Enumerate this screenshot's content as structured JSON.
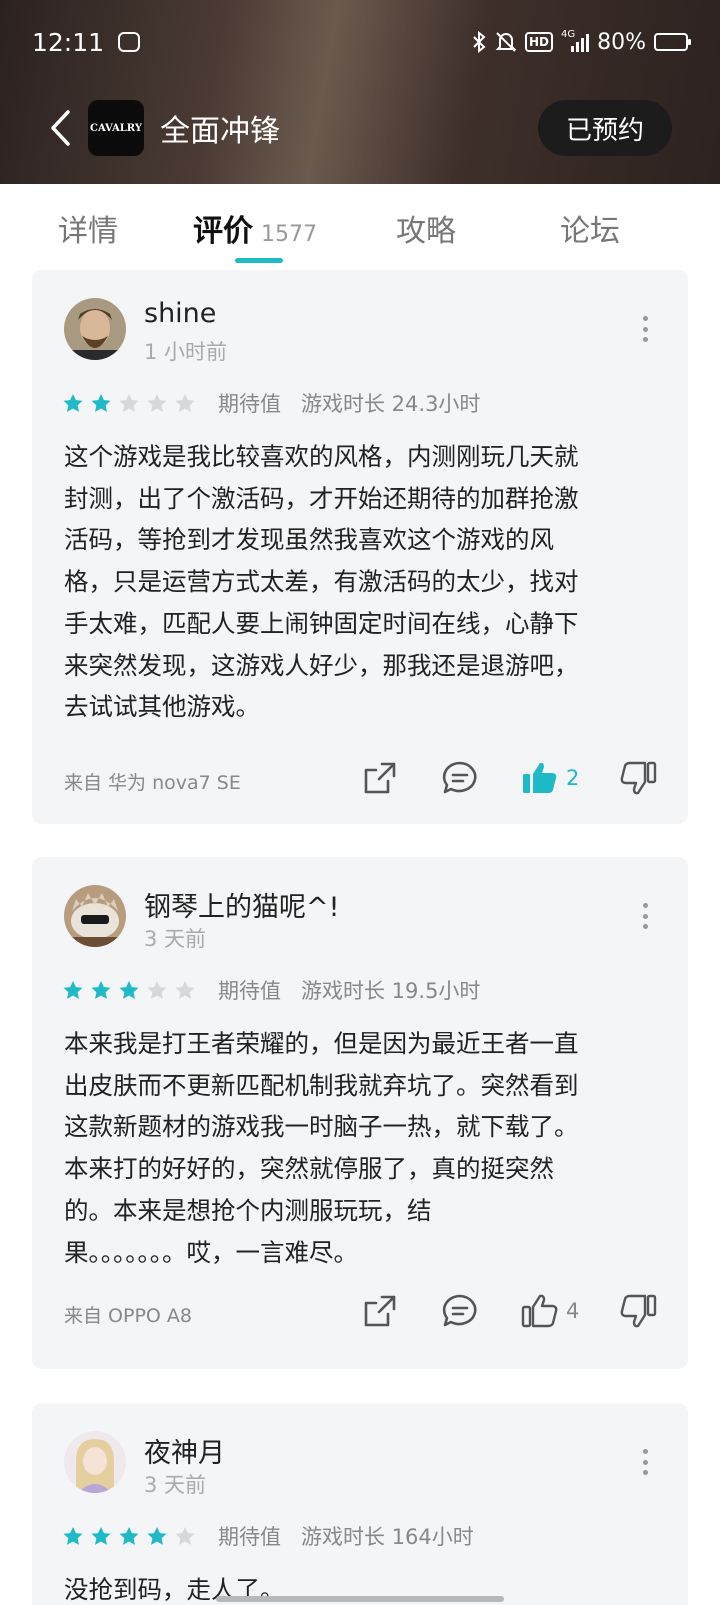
{
  "status_bar": {
    "time": "12:11",
    "hd": "HD",
    "network": "4G",
    "battery_text": "80%",
    "battery_level": 0.8
  },
  "header": {
    "logo_text": "CAVALRY",
    "title": "全面冲锋",
    "reserve_label": "已预约"
  },
  "tabs": [
    {
      "label": "详情"
    },
    {
      "label": "评价",
      "count": "1577"
    },
    {
      "label": "攻略"
    },
    {
      "label": "论坛"
    }
  ],
  "colors": {
    "accent": "#1fbac8",
    "star_off": "#d8d8d8"
  },
  "reviews": [
    {
      "name": "shine",
      "time": "1 小时前",
      "stars": 2,
      "expect_label": "期待值",
      "playtime": "游戏时长 24.3小时",
      "lines": [
        "这个游戏是我比较喜欢的风格，内测刚玩几天就",
        "封测，出了个激活码，才开始还期待的加群抢激",
        "活码，等抢到才发现虽然我喜欢这个游戏的风",
        "格，只是运营方式太差，有激活码的太少，找对",
        "手太难，匹配人要上闹钟固定时间在线，心静下",
        "来突然发现，这游戏人好少，那我还是退游吧，",
        "去试试其他游戏。"
      ],
      "device": "来自 华为 nova7 SE",
      "likes": "2",
      "liked": true
    },
    {
      "name": "钢琴上的猫呢^!",
      "time": "3 天前",
      "stars": 3,
      "expect_label": "期待值",
      "playtime": "游戏时长 19.5小时",
      "lines": [
        "本来我是打王者荣耀的，但是因为最近王者一直",
        "出皮肤而不更新匹配机制我就弃坑了。突然看到",
        "这款新题材的游戏我一时脑子一热，就下载了。",
        "本来打的好好的，突然就停服了，真的挺突然",
        "的。本来是想抢个内测服玩玩，结",
        "果。。。。。。。哎，一言难尽。"
      ],
      "device": "来自 OPPO A8",
      "likes": "4",
      "liked": false
    },
    {
      "name": "夜神月",
      "time": "3 天前",
      "stars": 4,
      "expect_label": "期待值",
      "playtime": "游戏时长 164小时",
      "lines": [
        "没抢到码，走人了。"
      ]
    }
  ]
}
